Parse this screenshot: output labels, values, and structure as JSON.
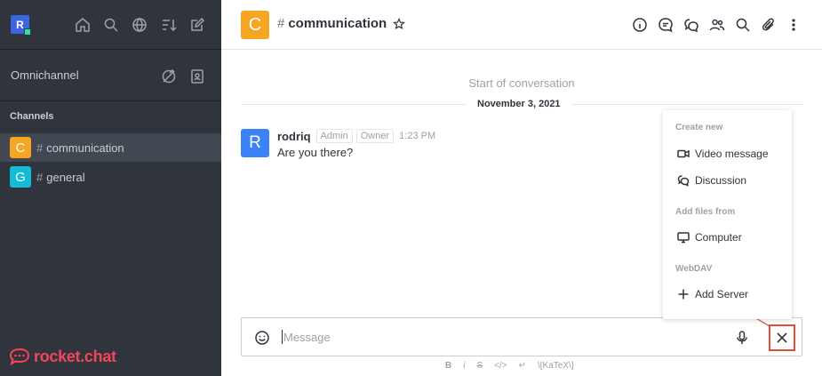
{
  "sidebar": {
    "user_initial": "R",
    "omnichannel_label": "Omnichannel",
    "channels_header": "Channels",
    "rooms": [
      {
        "initial": "C",
        "name": "communication",
        "color": "#f5a623"
      },
      {
        "initial": "G",
        "name": "general",
        "color": "#12bcd4"
      }
    ],
    "brand": "rocket.chat"
  },
  "header": {
    "room_initial": "C",
    "room_name": "communication"
  },
  "messages": {
    "start_text": "Start of conversation",
    "date": "November 3, 2021",
    "items": [
      {
        "initial": "R",
        "user": "rodriq",
        "roles": [
          "Admin",
          "Owner"
        ],
        "time": "1:23 PM",
        "text": "Are you there?"
      }
    ]
  },
  "menu": {
    "section_create": "Create new",
    "video_message": "Video message",
    "discussion": "Discussion",
    "section_files": "Add files from",
    "computer": "Computer",
    "section_webdav": "WebDAV",
    "add_server": "Add Server"
  },
  "composer": {
    "placeholder": "Message"
  },
  "format_bar": {
    "bold": "B",
    "italic": "i",
    "strike": "S",
    "code": "</>",
    "multiline": "↵",
    "katex": "\\[KaTeX\\]"
  },
  "colors": {
    "sidebar_bg": "#2f343d",
    "brand_red": "#f5455c",
    "highlight_red": "#e24d3b"
  }
}
